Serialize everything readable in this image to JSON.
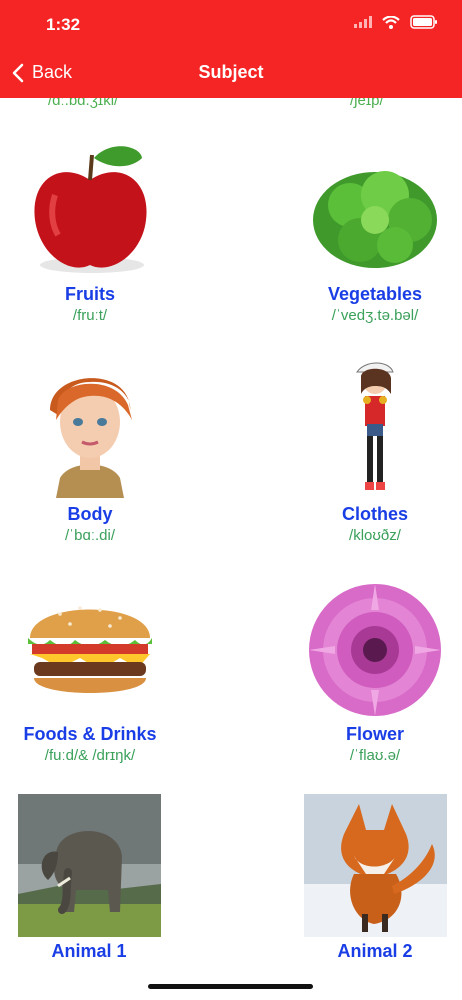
{
  "status": {
    "time": "1:32"
  },
  "nav": {
    "back_label": "Back",
    "title": "Subject"
  },
  "partial_row": {
    "left_phonetic": "/ɑː.bɑ.ʒɪkl/",
    "right_phonetic": "/ʃeɪp/"
  },
  "tiles": [
    {
      "label": "Fruits",
      "phonetic": "/fruːt/"
    },
    {
      "label": "Vegetables",
      "phonetic": "/ˈvedʒ.tə.bəl/"
    },
    {
      "label": "Body",
      "phonetic": "/ˈbɑː.di/"
    },
    {
      "label": "Clothes",
      "phonetic": "/kloʊðz/"
    },
    {
      "label": "Foods & Drinks",
      "phonetic": "/fuːd/& /drɪŋk/"
    },
    {
      "label": "Flower",
      "phonetic": "/ˈflaʊ.ə/"
    },
    {
      "label": "Animal 1",
      "phonetic": ""
    },
    {
      "label": "Animal 2",
      "phonetic": ""
    }
  ],
  "icons": [
    "signal-icon",
    "wifi-icon",
    "battery-icon",
    "back-chevron-icon"
  ]
}
